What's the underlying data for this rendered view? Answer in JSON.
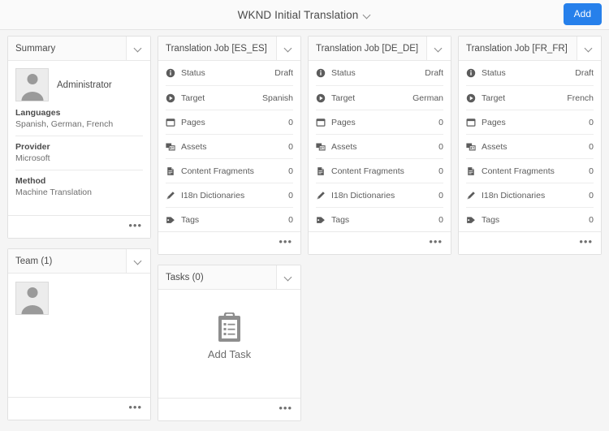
{
  "header": {
    "title": "WKND Initial Translation",
    "title_chevron_icon": "chevron-down-icon",
    "add_label": "Add"
  },
  "summary": {
    "title": "Summary",
    "toggle_icon": "chevron-down-icon",
    "user_name": "Administrator",
    "avatar_icon": "user-avatar-icon",
    "fields": [
      {
        "label": "Languages",
        "value": "Spanish, German, French"
      },
      {
        "label": "Provider",
        "value": "Microsoft"
      },
      {
        "label": "Method",
        "value": "Machine Translation"
      }
    ],
    "more_icon": "more-options-icon"
  },
  "team": {
    "title": "Team (1)",
    "toggle_icon": "chevron-down-icon",
    "members": [
      {
        "avatar_icon": "user-avatar-icon"
      }
    ],
    "more_icon": "more-options-icon"
  },
  "tasks": {
    "title": "Tasks (0)",
    "toggle_icon": "chevron-down-icon",
    "add_task_label": "Add Task",
    "add_task_icon": "task-list-icon",
    "more_icon": "more-options-icon"
  },
  "jobs": [
    {
      "title": "Translation Job [ES_ES]",
      "toggle_icon": "chevron-down-icon",
      "more_icon": "more-options-icon",
      "rows": [
        {
          "icon": "info-circle-icon",
          "label": "Status",
          "value": "Draft"
        },
        {
          "icon": "play-circle-icon",
          "label": "Target",
          "value": "Spanish"
        },
        {
          "icon": "page-icon",
          "label": "Pages",
          "value": "0"
        },
        {
          "icon": "assets-icon",
          "label": "Assets",
          "value": "0"
        },
        {
          "icon": "content-fragment-icon",
          "label": "Content Fragments",
          "value": "0"
        },
        {
          "icon": "dictionary-icon",
          "label": "I18n Dictionaries",
          "value": "0"
        },
        {
          "icon": "tag-icon",
          "label": "Tags",
          "value": "0"
        }
      ]
    },
    {
      "title": "Translation Job [DE_DE]",
      "toggle_icon": "chevron-down-icon",
      "more_icon": "more-options-icon",
      "rows": [
        {
          "icon": "info-circle-icon",
          "label": "Status",
          "value": "Draft"
        },
        {
          "icon": "play-circle-icon",
          "label": "Target",
          "value": "German"
        },
        {
          "icon": "page-icon",
          "label": "Pages",
          "value": "0"
        },
        {
          "icon": "assets-icon",
          "label": "Assets",
          "value": "0"
        },
        {
          "icon": "content-fragment-icon",
          "label": "Content Fragments",
          "value": "0"
        },
        {
          "icon": "dictionary-icon",
          "label": "I18n Dictionaries",
          "value": "0"
        },
        {
          "icon": "tag-icon",
          "label": "Tags",
          "value": "0"
        }
      ]
    },
    {
      "title": "Translation Job [FR_FR]",
      "toggle_icon": "chevron-down-icon",
      "more_icon": "more-options-icon",
      "rows": [
        {
          "icon": "info-circle-icon",
          "label": "Status",
          "value": "Draft"
        },
        {
          "icon": "play-circle-icon",
          "label": "Target",
          "value": "French"
        },
        {
          "icon": "page-icon",
          "label": "Pages",
          "value": "0"
        },
        {
          "icon": "assets-icon",
          "label": "Assets",
          "value": "0"
        },
        {
          "icon": "content-fragment-icon",
          "label": "Content Fragments",
          "value": "0"
        },
        {
          "icon": "dictionary-icon",
          "label": "I18n Dictionaries",
          "value": "0"
        },
        {
          "icon": "tag-icon",
          "label": "Tags",
          "value": "0"
        }
      ]
    }
  ],
  "glyphs": {
    "more": "•••"
  },
  "colors": {
    "accent": "#2680eb",
    "page_bg": "#f5f5f5",
    "card_bg": "#ffffff",
    "border": "#e1e1e1",
    "text": "#4b4b4b"
  }
}
